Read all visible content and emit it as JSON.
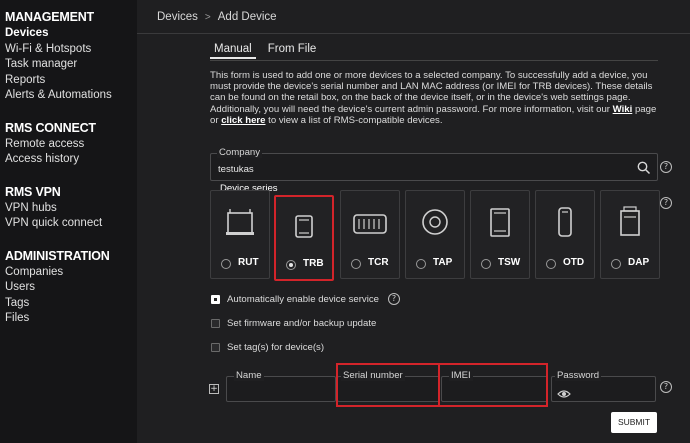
{
  "sidebar": {
    "sections": [
      {
        "heading": "MANAGEMENT",
        "items": [
          "Devices",
          "Wi-Fi & Hotspots",
          "Task manager",
          "Reports",
          "Alerts & Automations"
        ]
      },
      {
        "heading": "RMS CONNECT",
        "items": [
          "Remote access",
          "Access history"
        ]
      },
      {
        "heading": "RMS VPN",
        "items": [
          "VPN hubs",
          "VPN quick connect"
        ]
      },
      {
        "heading": "ADMINISTRATION",
        "items": [
          "Companies",
          "Users",
          "Tags",
          "Files"
        ]
      }
    ],
    "active_item": "Devices"
  },
  "breadcrumb": {
    "parent": "Devices",
    "separator": ">",
    "current": "Add Device"
  },
  "tabs": {
    "manual": "Manual",
    "from_file": "From File"
  },
  "intro": {
    "text_1": "This form is used to add one or more devices to a selected company. To successfully add a device, you must provide the device's serial number and LAN MAC address (or IMEI for TRB devices). These details can be found on the retail box, on the back of the device itself, or in the device's web settings page. Additionally, you will need the device's current admin password. For more information, visit our ",
    "link_wiki": "Wiki",
    "text_2": " page or ",
    "link_click": "click here",
    "text_3": " to view a list of RMS-compatible devices."
  },
  "company": {
    "label": "Company",
    "value": "testukas",
    "icon": "search-icon"
  },
  "series": {
    "label": "Device series",
    "cards": [
      {
        "name": "RUT",
        "selected": false
      },
      {
        "name": "TRB",
        "selected": true
      },
      {
        "name": "TCR",
        "selected": false
      },
      {
        "name": "TAP",
        "selected": false
      },
      {
        "name": "TSW",
        "selected": false
      },
      {
        "name": "OTD",
        "selected": false
      },
      {
        "name": "DAP",
        "selected": false
      }
    ]
  },
  "options": {
    "auto_enable": "Automatically enable device service",
    "firmware": "Set firmware and/or backup update",
    "tags": "Set tag(s) for device(s)"
  },
  "device_row": {
    "name_label": "Name",
    "serial_label": "Serial number",
    "imei_label": "IMEI",
    "password_label": "Password",
    "eye_icon": "eye-icon",
    "add_icon": "plus-icon"
  },
  "help_symbol": "?",
  "submit": "SUBMIT",
  "colors": {
    "highlight": "#d3242a",
    "background": "#1f1f21",
    "sidebar": "#151517"
  }
}
